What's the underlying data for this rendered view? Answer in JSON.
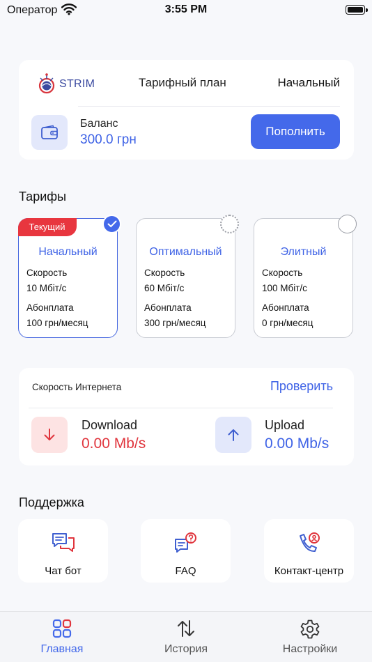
{
  "status_bar": {
    "carrier": "Оператор",
    "time": "3:55 PM"
  },
  "plan": {
    "brand": "STRIM",
    "label": "Тарифный план",
    "value": "Начальный",
    "balance_label": "Баланс",
    "balance_value": "300.0 грн",
    "topup_label": "Пополнить"
  },
  "tariffs": {
    "title": "Тарифы",
    "current_badge": "Текущий",
    "items": [
      {
        "name": "Начальный",
        "speed_label": "Скорость",
        "speed": "10 Мбіт/с",
        "fee_label": "Абонплата",
        "fee": "100 грн/месяц",
        "selected": true
      },
      {
        "name": "Оптимальный",
        "speed_label": "Скорость",
        "speed": "60 Мбіт/с",
        "fee_label": "Абонплата",
        "fee": "300 грн/месяц",
        "selected": false
      },
      {
        "name": "Элитный",
        "speed_label": "Скорость",
        "speed": "100 Мбіт/с",
        "fee_label": "Абонплата",
        "fee": "0 грн/месяц",
        "selected": false
      }
    ]
  },
  "speed": {
    "title": "Скорость Интернета",
    "check_label": "Проверить",
    "download_label": "Download",
    "download_value": "0.00 Mb/s",
    "upload_label": "Upload",
    "upload_value": "0.00 Mb/s"
  },
  "support": {
    "title": "Поддержка",
    "items": [
      {
        "label": "Чат бот",
        "icon": "chat-bot-icon"
      },
      {
        "label": "FAQ",
        "icon": "faq-icon"
      },
      {
        "label": "Контакт-центр",
        "icon": "contact-center-icon"
      }
    ]
  },
  "tabs": [
    {
      "label": "Главная",
      "icon": "home-grid-icon",
      "active": true
    },
    {
      "label": "История",
      "icon": "history-arrows-icon",
      "active": false
    },
    {
      "label": "Настройки",
      "icon": "settings-gear-icon",
      "active": false
    }
  ],
  "colors": {
    "accent": "#4469ea",
    "danger": "#e8363f",
    "background": "#f7f8fb"
  }
}
